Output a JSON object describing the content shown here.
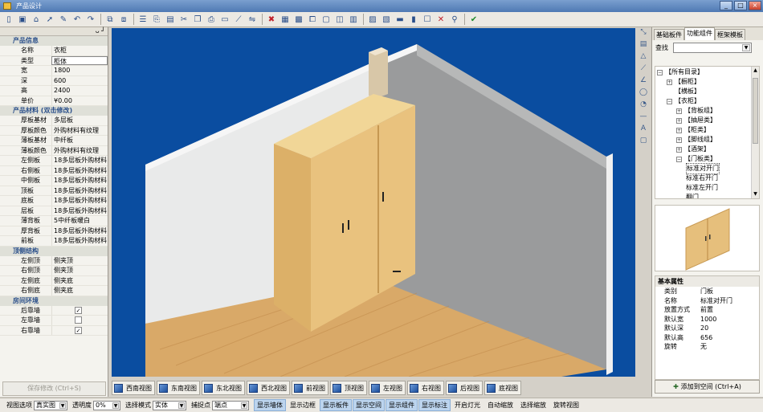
{
  "window": {
    "title": "产品设计",
    "buttons": {
      "minimize": "_",
      "restore": "□",
      "close": "×"
    }
  },
  "toolbar": {
    "icons": [
      "new-icon",
      "save-icon",
      "home-icon",
      "pointer-icon",
      "edit-icon",
      "undo-icon",
      "redo-icon",
      "group-icon",
      "ungroup-icon",
      "list-icon",
      "copy-icon",
      "paste-icon",
      "cut-icon",
      "duplicate-icon",
      "attach-icon",
      "note-icon",
      "link-icon",
      "mirror-icon",
      "delete-red-icon",
      "table-icon",
      "grid-icon",
      "clip-icon",
      "layout-a-icon",
      "layout-b-icon",
      "layout-c-icon",
      "layout-d-icon",
      "layout-e-icon",
      "row-icon",
      "col-icon",
      "select-all-icon",
      "clear-icon",
      "pin-icon",
      "check-icon"
    ]
  },
  "left": {
    "pin_glyph": "ᴗ ┘",
    "product_info": {
      "header": "产品信息",
      "rows": [
        {
          "label": "名称",
          "value": "衣柜"
        },
        {
          "label": "类型",
          "value": "柜体"
        },
        {
          "label": "宽",
          "value": "1800"
        },
        {
          "label": "深",
          "value": "600"
        },
        {
          "label": "高",
          "value": "2400"
        },
        {
          "label": "单价",
          "value": "¥0.00"
        }
      ]
    },
    "materials": {
      "header": "产品材料 (双击修改)",
      "rows": [
        {
          "label": "厚板基材",
          "value": "多层板"
        },
        {
          "label": "厚板颜色",
          "value": "外购材料有纹理"
        },
        {
          "label": "薄板基材",
          "value": "中纤板"
        },
        {
          "label": "薄板颜色",
          "value": "外购材料有纹理"
        },
        {
          "label": "左侧板",
          "value": "18多层板外购材料"
        },
        {
          "label": "右侧板",
          "value": "18多层板外购材料"
        },
        {
          "label": "中侧板",
          "value": "18多层板外购材料"
        },
        {
          "label": "顶板",
          "value": "18多层板外购材料"
        },
        {
          "label": "底板",
          "value": "18多层板外购材料"
        },
        {
          "label": "层板",
          "value": "18多层板外购材料"
        },
        {
          "label": "薄背板",
          "value": "5中纤板暖白"
        },
        {
          "label": "厚背板",
          "value": "18多层板外购材料"
        },
        {
          "label": "前板",
          "value": "18多层板外购材料"
        }
      ]
    },
    "structure": {
      "header": "顶侧结构",
      "rows": [
        {
          "label": "左侧顶",
          "value": "侧夹顶"
        },
        {
          "label": "右侧顶",
          "value": "侧夹顶"
        },
        {
          "label": "左侧底",
          "value": "侧夹底"
        },
        {
          "label": "右侧底",
          "value": "侧夹底"
        }
      ]
    },
    "room": {
      "header": "房间环境",
      "rows": [
        {
          "label": "后靠墙",
          "checked": true
        },
        {
          "label": "左靠墙",
          "checked": false
        },
        {
          "label": "右靠墙",
          "checked": true
        }
      ]
    },
    "save_button": "保存修改 (Ctrl+S)"
  },
  "viewbar": {
    "buttons": [
      "西南视图",
      "东南视图",
      "东北视图",
      "西北视图",
      "前视图",
      "顶视图",
      "左视图",
      "右视图",
      "后视图",
      "底视图"
    ]
  },
  "right": {
    "tabs": [
      "基础板件",
      "功能组件",
      "框架模板"
    ],
    "active_tab": 1,
    "search_label": "查找",
    "search_value": "",
    "tree": [
      {
        "label": "【所有目录】",
        "level": 0,
        "exp": "−"
      },
      {
        "label": "【橱柜】",
        "level": 1,
        "exp": "+"
      },
      {
        "label": "【横板】",
        "level": 1,
        "exp": ""
      },
      {
        "label": "【衣柜】",
        "level": 1,
        "exp": "−"
      },
      {
        "label": "【背板组】",
        "level": 2,
        "exp": "+"
      },
      {
        "label": "【抽屉类】",
        "level": 2,
        "exp": "+"
      },
      {
        "label": "【柜类】",
        "level": 2,
        "exp": "+"
      },
      {
        "label": "【脚线组】",
        "level": 2,
        "exp": "+"
      },
      {
        "label": "【酒架】",
        "level": 2,
        "exp": "+"
      },
      {
        "label": "【门板类】",
        "level": 2,
        "exp": "−"
      },
      {
        "label": "标准对开门",
        "level": 3,
        "exp": "",
        "selected": true
      },
      {
        "label": "标准右开门",
        "level": 3,
        "exp": ""
      },
      {
        "label": "标准左开门",
        "level": 3,
        "exp": ""
      },
      {
        "label": "翻门",
        "level": 3,
        "exp": ""
      }
    ],
    "props": {
      "header": "基本属性",
      "rows": [
        {
          "label": "类别",
          "value": "门板"
        },
        {
          "label": "名称",
          "value": "标准对开门"
        },
        {
          "label": "放置方式",
          "value": "前置"
        },
        {
          "label": "默认宽",
          "value": "1000"
        },
        {
          "label": "默认深",
          "value": "20"
        },
        {
          "label": "默认高",
          "value": "656"
        },
        {
          "label": "旋转",
          "value": "无"
        }
      ]
    },
    "add_button": "添加到空间 (Ctrl+A)"
  },
  "status": {
    "view_label": "视图选项",
    "view_value": "真实图",
    "transparency_label": "透明度",
    "transparency_value": "0%",
    "select_mode_label": "选择模式",
    "select_mode_value": "实体",
    "snap_label": "捕捉点",
    "snap_value": "端点",
    "toggles": [
      {
        "label": "显示墙体",
        "on": true
      },
      {
        "label": "显示边框",
        "on": false
      },
      {
        "label": "显示板件",
        "on": true
      },
      {
        "label": "显示空间",
        "on": true
      },
      {
        "label": "显示组件",
        "on": true
      },
      {
        "label": "显示标注",
        "on": true
      },
      {
        "label": "开启灯光",
        "on": false
      },
      {
        "label": "自动缩放",
        "on": false
      },
      {
        "label": "选择缩放",
        "on": false
      },
      {
        "label": "旋转视图",
        "on": false
      }
    ]
  }
}
